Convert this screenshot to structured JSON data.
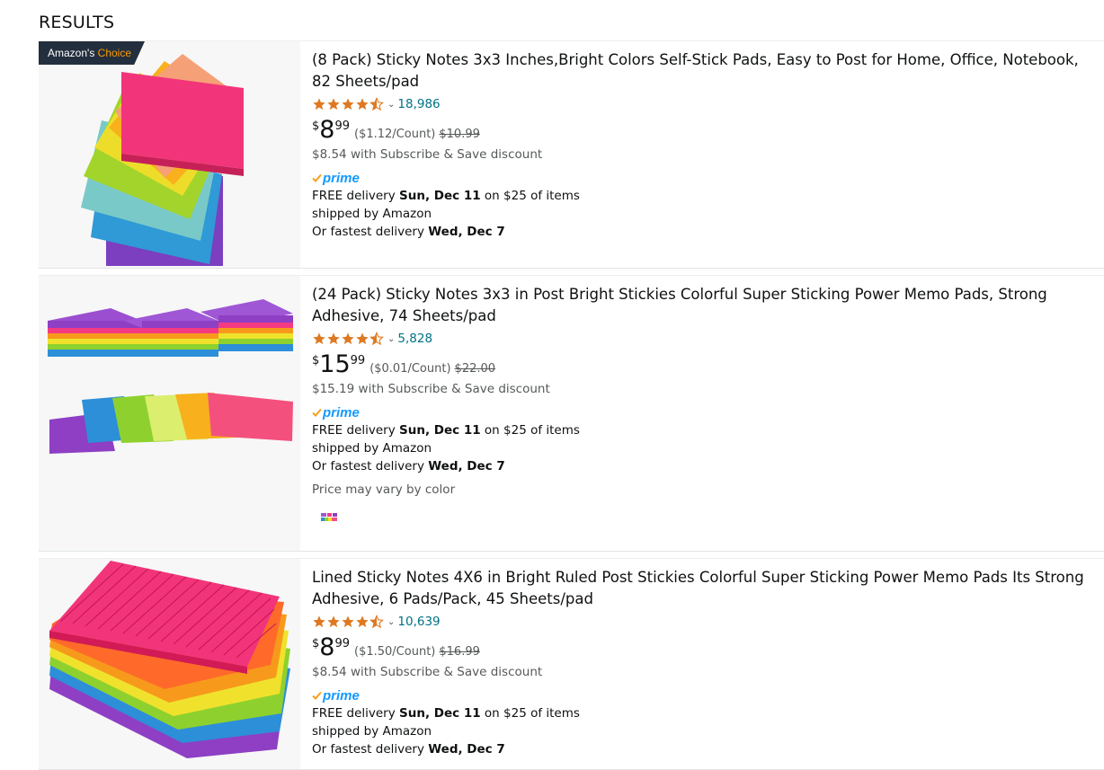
{
  "heading": "RESULTS",
  "badge": {
    "prefix": "Amazon's",
    "suffix": "Choice"
  },
  "products": [
    {
      "title": "(8 Pack) Sticky Notes 3x3 Inches,Bright Colors Self-Stick Pads, Easy to Post for Home, Office, Notebook, 82 Sheets/pad",
      "rating": 4.5,
      "reviews": "18,986",
      "price_currency": "$",
      "price_whole": "8",
      "price_fraction": "99",
      "per_unit": "($1.12/Count)",
      "list_price": "$10.99",
      "subscribe": "$8.54 with Subscribe & Save discount",
      "prime": "prime",
      "delivery_prefix": "FREE delivery ",
      "delivery_date": "Sun, Dec 11",
      "delivery_suffix": " on $25 of items",
      "shipped_by": "shipped by Amazon",
      "fastest_prefix": "Or fastest delivery ",
      "fastest_date": "Wed, Dec 7"
    },
    {
      "title": "(24 Pack) Sticky Notes 3x3 in Post Bright Stickies Colorful Super Sticking Power Memo Pads, Strong Adhesive, 74 Sheets/pad",
      "rating": 4.5,
      "reviews": "5,828",
      "price_currency": "$",
      "price_whole": "15",
      "price_fraction": "99",
      "per_unit": "($0.01/Count)",
      "list_price": "$22.00",
      "subscribe": "$15.19 with Subscribe & Save discount",
      "prime": "prime",
      "delivery_prefix": "FREE delivery ",
      "delivery_date": "Sun, Dec 11",
      "delivery_suffix": " on $25 of items",
      "shipped_by": "shipped by Amazon",
      "fastest_prefix": "Or fastest delivery ",
      "fastest_date": "Wed, Dec 7",
      "price_note": "Price may vary by color"
    },
    {
      "title": "Lined Sticky Notes 4X6 in Bright Ruled Post Stickies Colorful Super Sticking Power Memo Pads Its Strong Adhesive, 6 Pads/Pack, 45 Sheets/pad",
      "rating": 4.5,
      "reviews": "10,639",
      "price_currency": "$",
      "price_whole": "8",
      "price_fraction": "99",
      "per_unit": "($1.50/Count)",
      "list_price": "$16.99",
      "subscribe": "$8.54 with Subscribe & Save discount",
      "prime": "prime",
      "delivery_prefix": "FREE delivery ",
      "delivery_date": "Sun, Dec 11",
      "delivery_suffix": " on $25 of items",
      "shipped_by": "shipped by Amazon",
      "fastest_prefix": "Or fastest delivery ",
      "fastest_date": "Wed, Dec 7"
    }
  ],
  "colors": {
    "star": "#de7921",
    "link": "#007185",
    "prime": "#1399ff",
    "badge_bg": "#232f3e",
    "badge_accent": "#ff9900"
  }
}
